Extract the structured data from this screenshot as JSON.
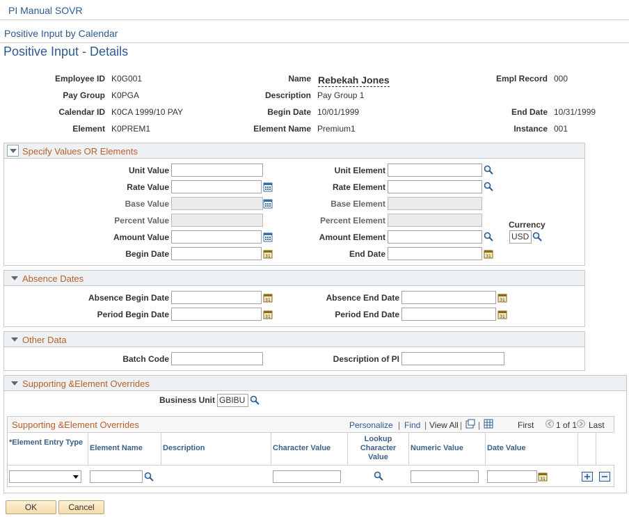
{
  "header": {
    "app_title": "PI Manual SOVR",
    "breadcrumb": "Positive Input by Calendar",
    "page_title": "Positive Input - Details"
  },
  "summary": {
    "employee_id_label": "Employee ID",
    "employee_id": "K0G001",
    "name_label": "Name",
    "name": "Rebekah Jones",
    "empl_record_label": "Empl Record",
    "empl_record": "000",
    "pay_group_label": "Pay Group",
    "pay_group": "K0PGA",
    "description_label": "Description",
    "description": "Pay Group 1",
    "calendar_id_label": "Calendar ID",
    "calendar_id": "K0CA 1999/10 PAY",
    "begin_date_label": "Begin Date",
    "begin_date": "10/01/1999",
    "end_date_label": "End Date",
    "end_date": "10/31/1999",
    "element_label": "Element",
    "element": "K0PREM1",
    "element_name_label": "Element Name",
    "element_name": "Premium1",
    "instance_label": "Instance",
    "instance": "001"
  },
  "specify": {
    "title": "Specify Values OR Elements",
    "unit_value": "Unit Value",
    "rate_value": "Rate Value",
    "base_value": "Base Value",
    "percent_value": "Percent Value",
    "amount_value": "Amount Value",
    "begin_date": "Begin Date",
    "unit_element": "Unit Element",
    "rate_element": "Rate Element",
    "base_element": "Base Element",
    "percent_element": "Percent Element",
    "amount_element": "Amount Element",
    "end_date": "End Date",
    "currency_label": "Currency",
    "currency_value": "USD"
  },
  "absence": {
    "title": "Absence Dates",
    "absence_begin": "Absence Begin Date",
    "absence_end": "Absence End Date",
    "period_begin": "Period Begin Date",
    "period_end": "Period End Date"
  },
  "other": {
    "title": "Other Data",
    "batch_code": "Batch Code",
    "description_pi": "Description of PI"
  },
  "overrides": {
    "title": "Supporting &Element Overrides",
    "business_unit_label": "Business Unit",
    "business_unit": "GBIBU",
    "grid_title": "Supporting &Element Overrides",
    "personalize": "Personalize",
    "find": "Find",
    "view_all": "View All",
    "first": "First",
    "pager": "1 of 1",
    "last": "Last",
    "columns": [
      "*Element Entry Type",
      "Element Name",
      "Description",
      "Character Value",
      "Lookup Character Value",
      "Numeric Value",
      "Date Value"
    ]
  },
  "buttons": {
    "ok": "OK",
    "cancel": "Cancel"
  },
  "colors": {
    "link": "#2d5a8e",
    "section_title": "#b8602a",
    "header_bg": "#eef1f4",
    "button_bg": "#f6dca9"
  },
  "icons": [
    "search-icon",
    "calendar-icon",
    "calculator-icon",
    "dropdown-arrow-icon",
    "add-row-icon",
    "delete-row-icon",
    "prev-icon",
    "next-icon"
  ]
}
